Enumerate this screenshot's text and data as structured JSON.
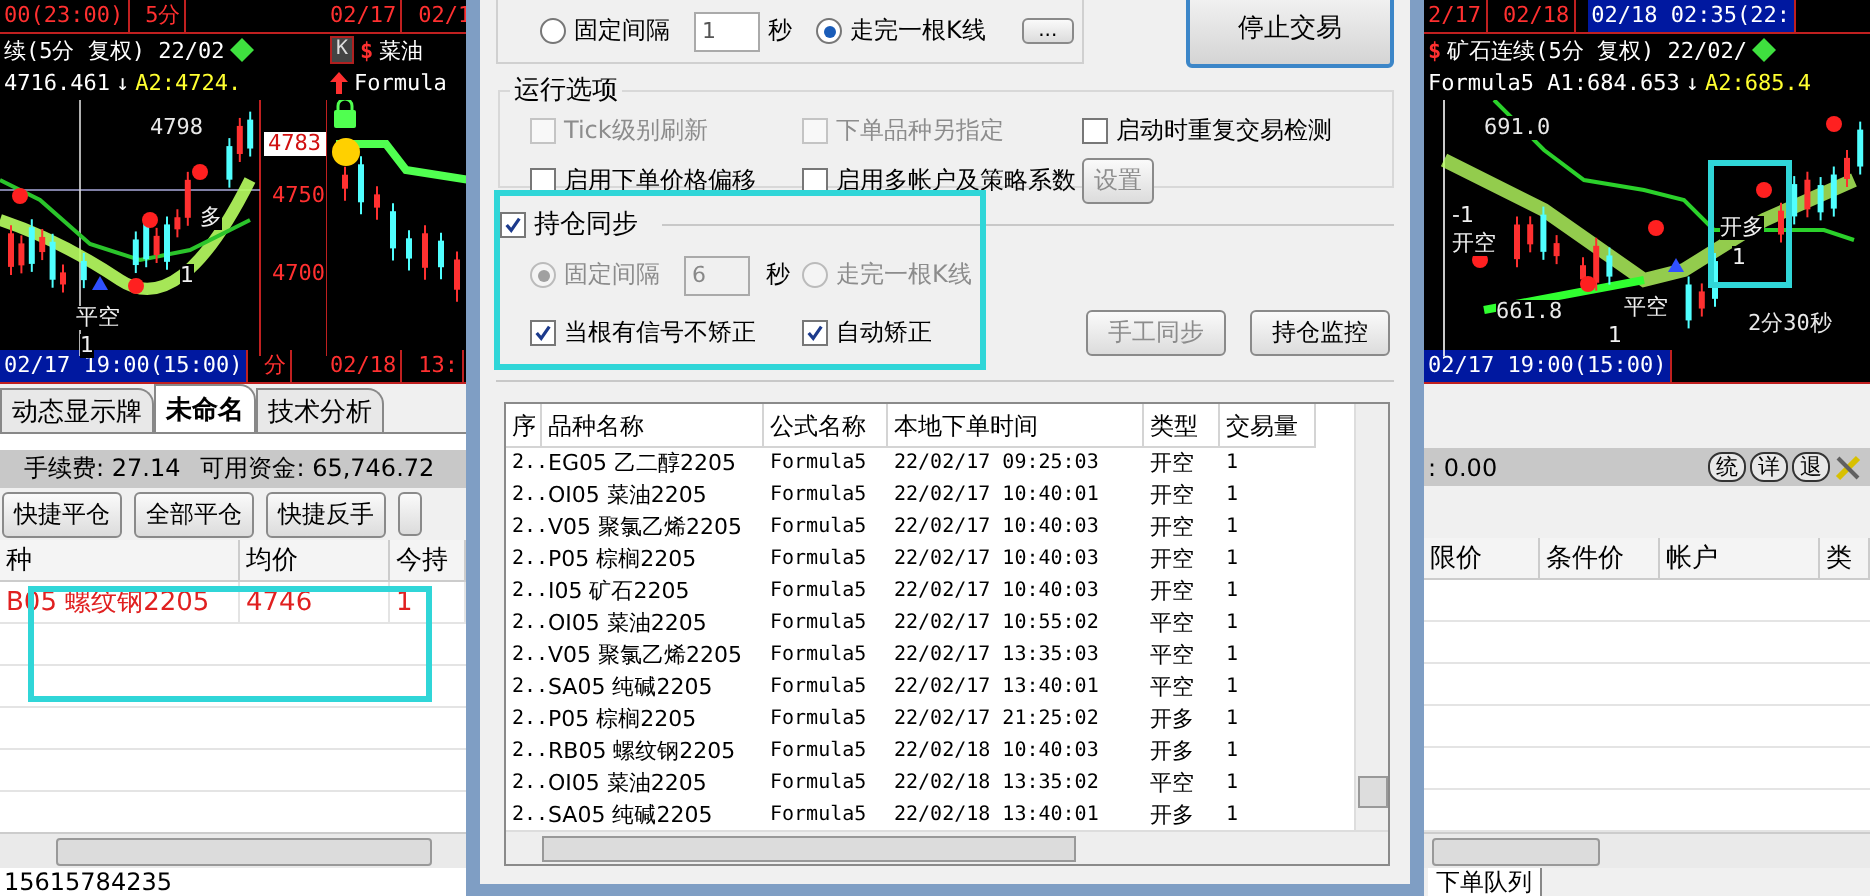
{
  "left_chart": {
    "top_bar": [
      {
        "text": "00(23:00)",
        "selected": false
      },
      {
        "text": "5分",
        "selected": false
      }
    ],
    "title": "续(5分 复权) 22/02",
    "value_line": "4716.461",
    "trend": "↓",
    "a2": "A2:4724.",
    "labels": [
      {
        "text": "4798",
        "kind": "note"
      },
      {
        "text": "4783",
        "kind": "price_tag"
      },
      {
        "text": "4750",
        "kind": "axis"
      },
      {
        "text": "4700",
        "kind": "axis"
      },
      {
        "text": "平空",
        "kind": "signal"
      },
      {
        "text": "1",
        "kind": "signal"
      },
      {
        "text": "多",
        "kind": "signal"
      },
      {
        "text": "1",
        "kind": "signal"
      }
    ],
    "bottom_bar": [
      {
        "text": "02/17 19:00(15:00)",
        "selected": true
      },
      {
        "text": "分",
        "selected": false
      }
    ]
  },
  "middle_chart": {
    "top_bar": [
      {
        "text": "02/17",
        "selected": false
      },
      {
        "text": "02/1",
        "selected": false
      }
    ],
    "k_button": "K",
    "currency": "$",
    "title": "菜油",
    "formula": "Formula",
    "bottom_bar": [
      {
        "text": "02/18",
        "selected": false
      },
      {
        "text": "13:",
        "selected": false
      }
    ]
  },
  "right_chart": {
    "top_bar": [
      {
        "text": "2/17",
        "selected": false
      },
      {
        "text": "02/18",
        "selected": false
      },
      {
        "text": "02/18 02:35(22:",
        "selected": true
      }
    ],
    "currency": "$",
    "title": "矿石连续(5分 复权) 22/02/",
    "value_line": "Formula5 A1:684.653",
    "trend": "↓",
    "a2": "A2:685.4",
    "labels": [
      {
        "text": "691.0",
        "kind": "note"
      },
      {
        "text": "-1",
        "kind": "signal"
      },
      {
        "text": "开空",
        "kind": "signal"
      },
      {
        "text": "661.8",
        "kind": "note"
      },
      {
        "text": "平空",
        "kind": "signal"
      },
      {
        "text": "1",
        "kind": "signal"
      },
      {
        "text": "开多",
        "kind": "signal"
      },
      {
        "text": "1",
        "kind": "signal"
      },
      {
        "text": "2分30秒",
        "kind": "note"
      }
    ],
    "bottom_bar": [
      {
        "text": "02/17 19:00(15:00)",
        "selected": true
      }
    ]
  },
  "tabs": [
    {
      "label": "动态显示牌",
      "selected": false
    },
    {
      "label": "未命名",
      "selected": true
    },
    {
      "label": "技术分析",
      "selected": false
    }
  ],
  "account": {
    "fee": "手续费: 27.14",
    "funds": "可用资金: 65,746.72",
    "margin": ": 0.00",
    "actions": [
      "统",
      "详",
      "退"
    ]
  },
  "quick_buttons": [
    "快捷平仓",
    "全部平仓",
    "快捷反手"
  ],
  "positions": {
    "columns": [
      "种",
      "均价",
      "今持"
    ],
    "rows": [
      [
        "B05 螺纹钢2205",
        "4746",
        "1"
      ]
    ]
  },
  "orders": {
    "columns": [
      "限价",
      "条件价",
      "帐户",
      "类"
    ]
  },
  "account_number": "15615784235",
  "queue_tab": "下单队列",
  "dialog": {
    "interval_modes": [
      {
        "label": "固定间隔",
        "selected": false
      },
      {
        "label": "走完一根K线",
        "selected": true
      }
    ],
    "interval_value": "1",
    "interval_unit": "秒",
    "more_button": "...",
    "stop_button": "停止交易",
    "run_options": {
      "title": "运行选项",
      "options": [
        {
          "label": "Tick级别刷新",
          "checked": false,
          "disabled": true
        },
        {
          "label": "下单品种另指定",
          "checked": false,
          "disabled": true
        },
        {
          "label": "启动时重复交易检测",
          "checked": false,
          "disabled": false
        },
        {
          "label": "启用下单价格偏移",
          "checked": false,
          "disabled": false
        },
        {
          "label": "启用多帐户及策略系数",
          "checked": false,
          "disabled": false
        }
      ],
      "settings_button": {
        "label": "设置",
        "disabled": true
      }
    },
    "sync": {
      "label": "持仓同步",
      "checked": true,
      "modes": [
        {
          "label": "固定间隔",
          "selected": true,
          "disabled": true
        },
        {
          "label": "走完一根K线",
          "selected": false,
          "disabled": true
        }
      ],
      "interval_value": "6",
      "interval_unit": "秒",
      "options": [
        {
          "label": "当根有信号不矫正",
          "checked": true
        },
        {
          "label": "自动矫正",
          "checked": true
        }
      ],
      "buttons": [
        {
          "label": "手工同步",
          "disabled": true
        },
        {
          "label": "持仓监控",
          "disabled": false
        }
      ]
    },
    "table": {
      "columns": [
        "序",
        "品种名称",
        "公式名称",
        "本地下单时间",
        "类型",
        "交易量"
      ],
      "rows": [
        [
          "2..",
          "EG05 乙二醇2205",
          "Formula5",
          "22/02/17 09:25:03",
          "开空",
          "1"
        ],
        [
          "2..",
          "OI05 菜油2205",
          "Formula5",
          "22/02/17 10:40:01",
          "开空",
          "1"
        ],
        [
          "2..",
          "V05 聚氯乙烯2205",
          "Formula5",
          "22/02/17 10:40:03",
          "开空",
          "1"
        ],
        [
          "2..",
          "P05 棕榈2205",
          "Formula5",
          "22/02/17 10:40:03",
          "开空",
          "1"
        ],
        [
          "2..",
          "I05 矿石2205",
          "Formula5",
          "22/02/17 10:40:03",
          "开空",
          "1"
        ],
        [
          "2..",
          "OI05 菜油2205",
          "Formula5",
          "22/02/17 10:55:02",
          "平空",
          "1"
        ],
        [
          "2..",
          "V05 聚氯乙烯2205",
          "Formula5",
          "22/02/17 13:35:03",
          "平空",
          "1"
        ],
        [
          "2..",
          "SA05 纯碱2205",
          "Formula5",
          "22/02/17 13:40:01",
          "平空",
          "1"
        ],
        [
          "2..",
          "P05 棕榈2205",
          "Formula5",
          "22/02/17 21:25:02",
          "开多",
          "1"
        ],
        [
          "2..",
          "RB05 螺纹钢2205",
          "Formula5",
          "22/02/18 10:40:03",
          "开多",
          "1"
        ],
        [
          "2..",
          "OI05 菜油2205",
          "Formula5",
          "22/02/18 13:35:02",
          "平空",
          "1"
        ],
        [
          "2..",
          "SA05 纯碱2205",
          "Formula5",
          "22/02/18 13:40:01",
          "开多",
          "1"
        ]
      ]
    }
  }
}
